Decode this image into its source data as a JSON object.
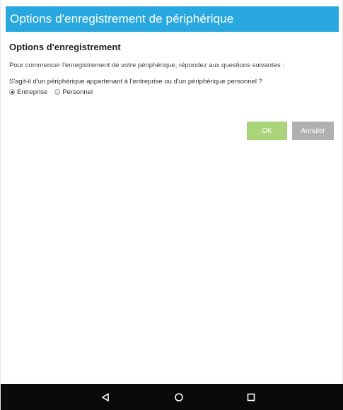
{
  "header": {
    "title": "Options d'enregistrement de périphérique"
  },
  "main": {
    "section_title": "Options d'enregistrement",
    "intro_text": "Pour commencer l'enregistrement de votre périphérique, répondez aux questions suivantes :",
    "question": "S'agit-il d'un périphérique appartenant à l'entreprise ou d'un périphérique personnel ?",
    "options": [
      {
        "label": "Entreprise",
        "selected": true
      },
      {
        "label": "Personnel",
        "selected": false
      }
    ]
  },
  "buttons": {
    "ok_label": "OK",
    "cancel_label": "Annuler"
  },
  "nav": {
    "back_icon": "back-triangle-icon",
    "home_icon": "home-circle-icon",
    "recent_icon": "recent-apps-square-icon"
  },
  "colors": {
    "header_bg": "#29a8e0",
    "ok_bg": "#a9d47a",
    "cancel_bg": "#b0b0b0",
    "navbar_bg": "#0a0a0a"
  }
}
